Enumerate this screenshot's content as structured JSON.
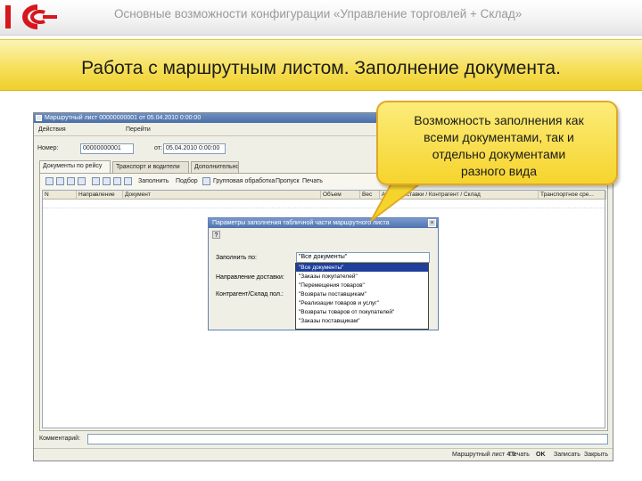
{
  "header": {
    "logo_text": "1C",
    "title": "Основные возможности конфигурации «Управление торговлей + Склад»",
    "slide_title": "Работа с маршрутным листом. Заполнение документа."
  },
  "callout": {
    "lines": [
      "Возможность заполнения как",
      "всеми документами, так и",
      "отдельно документами",
      "разного вида"
    ]
  },
  "window": {
    "title": "Маршрутный лист 00000000001 от 05.04.2010 0:00:00",
    "menu": [
      "Действия",
      "Перейти"
    ],
    "fields": {
      "number_label": "Номер:",
      "number_value": "00000000001",
      "date_label": "от:",
      "date_value": "05.04.2010 0:00:00"
    },
    "tabs": [
      "Документы по рейсу",
      "Транспорт и водители",
      "Дополнительно"
    ],
    "toolbar": {
      "fill_label": "Заполнить",
      "selection_label": "Подбор",
      "group_label": "Групповая обработка",
      "pass_label": "Пропуск",
      "print_label": "Печать"
    },
    "columns": [
      "N",
      "Направление",
      "Документ",
      "Объем",
      "Вес",
      "Адрес доставки / Контрагент / Склад",
      "Транспортное сре..."
    ],
    "comment_label": "Комментарий:",
    "bottom_buttons": [
      "Маршрутный лист 4.0",
      "Печать",
      "OK",
      "Записать",
      "Закрыть"
    ]
  },
  "dialog": {
    "title": "Параметры заполнения табличной части маршрутного листа",
    "help": "?",
    "close": "×",
    "rows": [
      {
        "label": "Заполнить по:",
        "value": "\"Все документы\""
      },
      {
        "label": "Направление доставки:",
        "value": ""
      },
      {
        "label": "Контрагент/Склад пол.:",
        "value": ""
      }
    ],
    "dropdown_options": [
      "\"Все документы\"",
      "\"Заказы покупателей\"",
      "\"Перемещения товаров\"",
      "\"Возвраты поставщикам\"",
      "\"Реализации товаров и услуг\"",
      "\"Возвраты товаров от покупателей\"",
      "\"Заказы поставщикам\""
    ]
  },
  "colors": {
    "title_band": "#f6e05a",
    "callout_fill": "#f6d42c",
    "callout_border": "#e0a826",
    "window_bg": "#f0efe6",
    "selection": "#1f3f9a"
  }
}
